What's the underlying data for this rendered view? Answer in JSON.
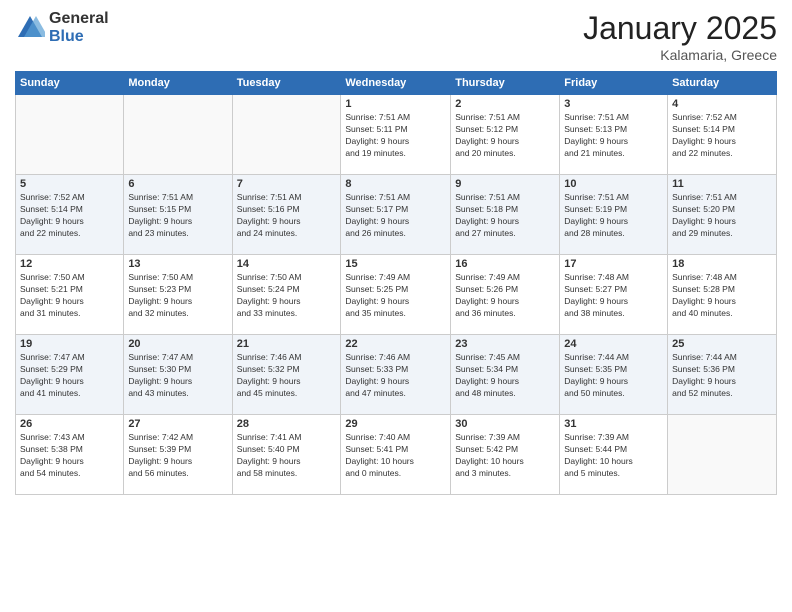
{
  "logo": {
    "general": "General",
    "blue": "Blue"
  },
  "header": {
    "month": "January 2025",
    "location": "Kalamaria, Greece"
  },
  "weekdays": [
    "Sunday",
    "Monday",
    "Tuesday",
    "Wednesday",
    "Thursday",
    "Friday",
    "Saturday"
  ],
  "weeks": [
    [
      {
        "day": "",
        "info": ""
      },
      {
        "day": "",
        "info": ""
      },
      {
        "day": "",
        "info": ""
      },
      {
        "day": "1",
        "info": "Sunrise: 7:51 AM\nSunset: 5:11 PM\nDaylight: 9 hours\nand 19 minutes."
      },
      {
        "day": "2",
        "info": "Sunrise: 7:51 AM\nSunset: 5:12 PM\nDaylight: 9 hours\nand 20 minutes."
      },
      {
        "day": "3",
        "info": "Sunrise: 7:51 AM\nSunset: 5:13 PM\nDaylight: 9 hours\nand 21 minutes."
      },
      {
        "day": "4",
        "info": "Sunrise: 7:52 AM\nSunset: 5:14 PM\nDaylight: 9 hours\nand 22 minutes."
      }
    ],
    [
      {
        "day": "5",
        "info": "Sunrise: 7:52 AM\nSunset: 5:14 PM\nDaylight: 9 hours\nand 22 minutes."
      },
      {
        "day": "6",
        "info": "Sunrise: 7:51 AM\nSunset: 5:15 PM\nDaylight: 9 hours\nand 23 minutes."
      },
      {
        "day": "7",
        "info": "Sunrise: 7:51 AM\nSunset: 5:16 PM\nDaylight: 9 hours\nand 24 minutes."
      },
      {
        "day": "8",
        "info": "Sunrise: 7:51 AM\nSunset: 5:17 PM\nDaylight: 9 hours\nand 26 minutes."
      },
      {
        "day": "9",
        "info": "Sunrise: 7:51 AM\nSunset: 5:18 PM\nDaylight: 9 hours\nand 27 minutes."
      },
      {
        "day": "10",
        "info": "Sunrise: 7:51 AM\nSunset: 5:19 PM\nDaylight: 9 hours\nand 28 minutes."
      },
      {
        "day": "11",
        "info": "Sunrise: 7:51 AM\nSunset: 5:20 PM\nDaylight: 9 hours\nand 29 minutes."
      }
    ],
    [
      {
        "day": "12",
        "info": "Sunrise: 7:50 AM\nSunset: 5:21 PM\nDaylight: 9 hours\nand 31 minutes."
      },
      {
        "day": "13",
        "info": "Sunrise: 7:50 AM\nSunset: 5:23 PM\nDaylight: 9 hours\nand 32 minutes."
      },
      {
        "day": "14",
        "info": "Sunrise: 7:50 AM\nSunset: 5:24 PM\nDaylight: 9 hours\nand 33 minutes."
      },
      {
        "day": "15",
        "info": "Sunrise: 7:49 AM\nSunset: 5:25 PM\nDaylight: 9 hours\nand 35 minutes."
      },
      {
        "day": "16",
        "info": "Sunrise: 7:49 AM\nSunset: 5:26 PM\nDaylight: 9 hours\nand 36 minutes."
      },
      {
        "day": "17",
        "info": "Sunrise: 7:48 AM\nSunset: 5:27 PM\nDaylight: 9 hours\nand 38 minutes."
      },
      {
        "day": "18",
        "info": "Sunrise: 7:48 AM\nSunset: 5:28 PM\nDaylight: 9 hours\nand 40 minutes."
      }
    ],
    [
      {
        "day": "19",
        "info": "Sunrise: 7:47 AM\nSunset: 5:29 PM\nDaylight: 9 hours\nand 41 minutes."
      },
      {
        "day": "20",
        "info": "Sunrise: 7:47 AM\nSunset: 5:30 PM\nDaylight: 9 hours\nand 43 minutes."
      },
      {
        "day": "21",
        "info": "Sunrise: 7:46 AM\nSunset: 5:32 PM\nDaylight: 9 hours\nand 45 minutes."
      },
      {
        "day": "22",
        "info": "Sunrise: 7:46 AM\nSunset: 5:33 PM\nDaylight: 9 hours\nand 47 minutes."
      },
      {
        "day": "23",
        "info": "Sunrise: 7:45 AM\nSunset: 5:34 PM\nDaylight: 9 hours\nand 48 minutes."
      },
      {
        "day": "24",
        "info": "Sunrise: 7:44 AM\nSunset: 5:35 PM\nDaylight: 9 hours\nand 50 minutes."
      },
      {
        "day": "25",
        "info": "Sunrise: 7:44 AM\nSunset: 5:36 PM\nDaylight: 9 hours\nand 52 minutes."
      }
    ],
    [
      {
        "day": "26",
        "info": "Sunrise: 7:43 AM\nSunset: 5:38 PM\nDaylight: 9 hours\nand 54 minutes."
      },
      {
        "day": "27",
        "info": "Sunrise: 7:42 AM\nSunset: 5:39 PM\nDaylight: 9 hours\nand 56 minutes."
      },
      {
        "day": "28",
        "info": "Sunrise: 7:41 AM\nSunset: 5:40 PM\nDaylight: 9 hours\nand 58 minutes."
      },
      {
        "day": "29",
        "info": "Sunrise: 7:40 AM\nSunset: 5:41 PM\nDaylight: 10 hours\nand 0 minutes."
      },
      {
        "day": "30",
        "info": "Sunrise: 7:39 AM\nSunset: 5:42 PM\nDaylight: 10 hours\nand 3 minutes."
      },
      {
        "day": "31",
        "info": "Sunrise: 7:39 AM\nSunset: 5:44 PM\nDaylight: 10 hours\nand 5 minutes."
      },
      {
        "day": "",
        "info": ""
      }
    ]
  ]
}
